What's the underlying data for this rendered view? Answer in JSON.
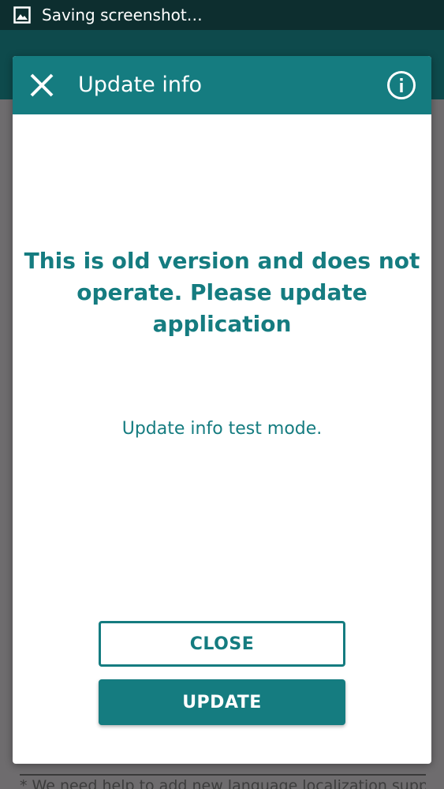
{
  "status_bar": {
    "text": "Saving screenshot…",
    "icon": "image-icon"
  },
  "dialog": {
    "title": "Update info",
    "close_icon": "close-icon",
    "info_icon": "info-icon",
    "headline": "This is old version and does not operate. Please update application",
    "subtext": "Update info test mode.",
    "close_label": "CLOSE",
    "update_label": "UPDATE"
  },
  "background": {
    "snippet": "* We need help to add new language localization support for"
  },
  "colors": {
    "accent": "#157c80",
    "status_bar": "#0d2e2f",
    "overlay": "#6e6c6e"
  }
}
